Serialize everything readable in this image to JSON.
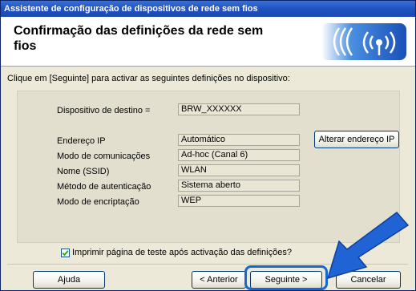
{
  "window": {
    "title": "Assistente de configuração de dispositivos de rede sem fios"
  },
  "header": {
    "title": "Confirmação das definições da rede sem fios"
  },
  "instruction": "Clique em [Seguinte] para activar as seguintes definições no dispositivo:",
  "destination": {
    "label": "Dispositivo de destino =",
    "value": "BRW_XXXXXX"
  },
  "fields": [
    {
      "label": "Endereço IP",
      "value": "Automático"
    },
    {
      "label": "Modo de comunicações",
      "value": "Ad-hoc (Canal 6)"
    },
    {
      "label": "Nome (SSID)",
      "value": "WLAN"
    },
    {
      "label": "Método de autenticação",
      "value": "Sistema aberto"
    },
    {
      "label": "Modo de encriptação",
      "value": "WEP"
    }
  ],
  "change_ip_button": "Alterar endereço IP",
  "print_test": {
    "label": "Imprimir página de teste após activação das definições?",
    "checked": true
  },
  "buttons": {
    "help": "Ajuda",
    "back": "< Anterior",
    "next": "Seguinte >",
    "cancel": "Cancelar"
  },
  "colors": {
    "title_bar": "#2155c4",
    "dialog_bg": "#ece9d8",
    "highlight": "#1468d2"
  },
  "icons": {
    "logo": "wireless-signal-logo",
    "checkbox": "checkmark-icon",
    "pointer": "arrow-pointer-icon"
  }
}
